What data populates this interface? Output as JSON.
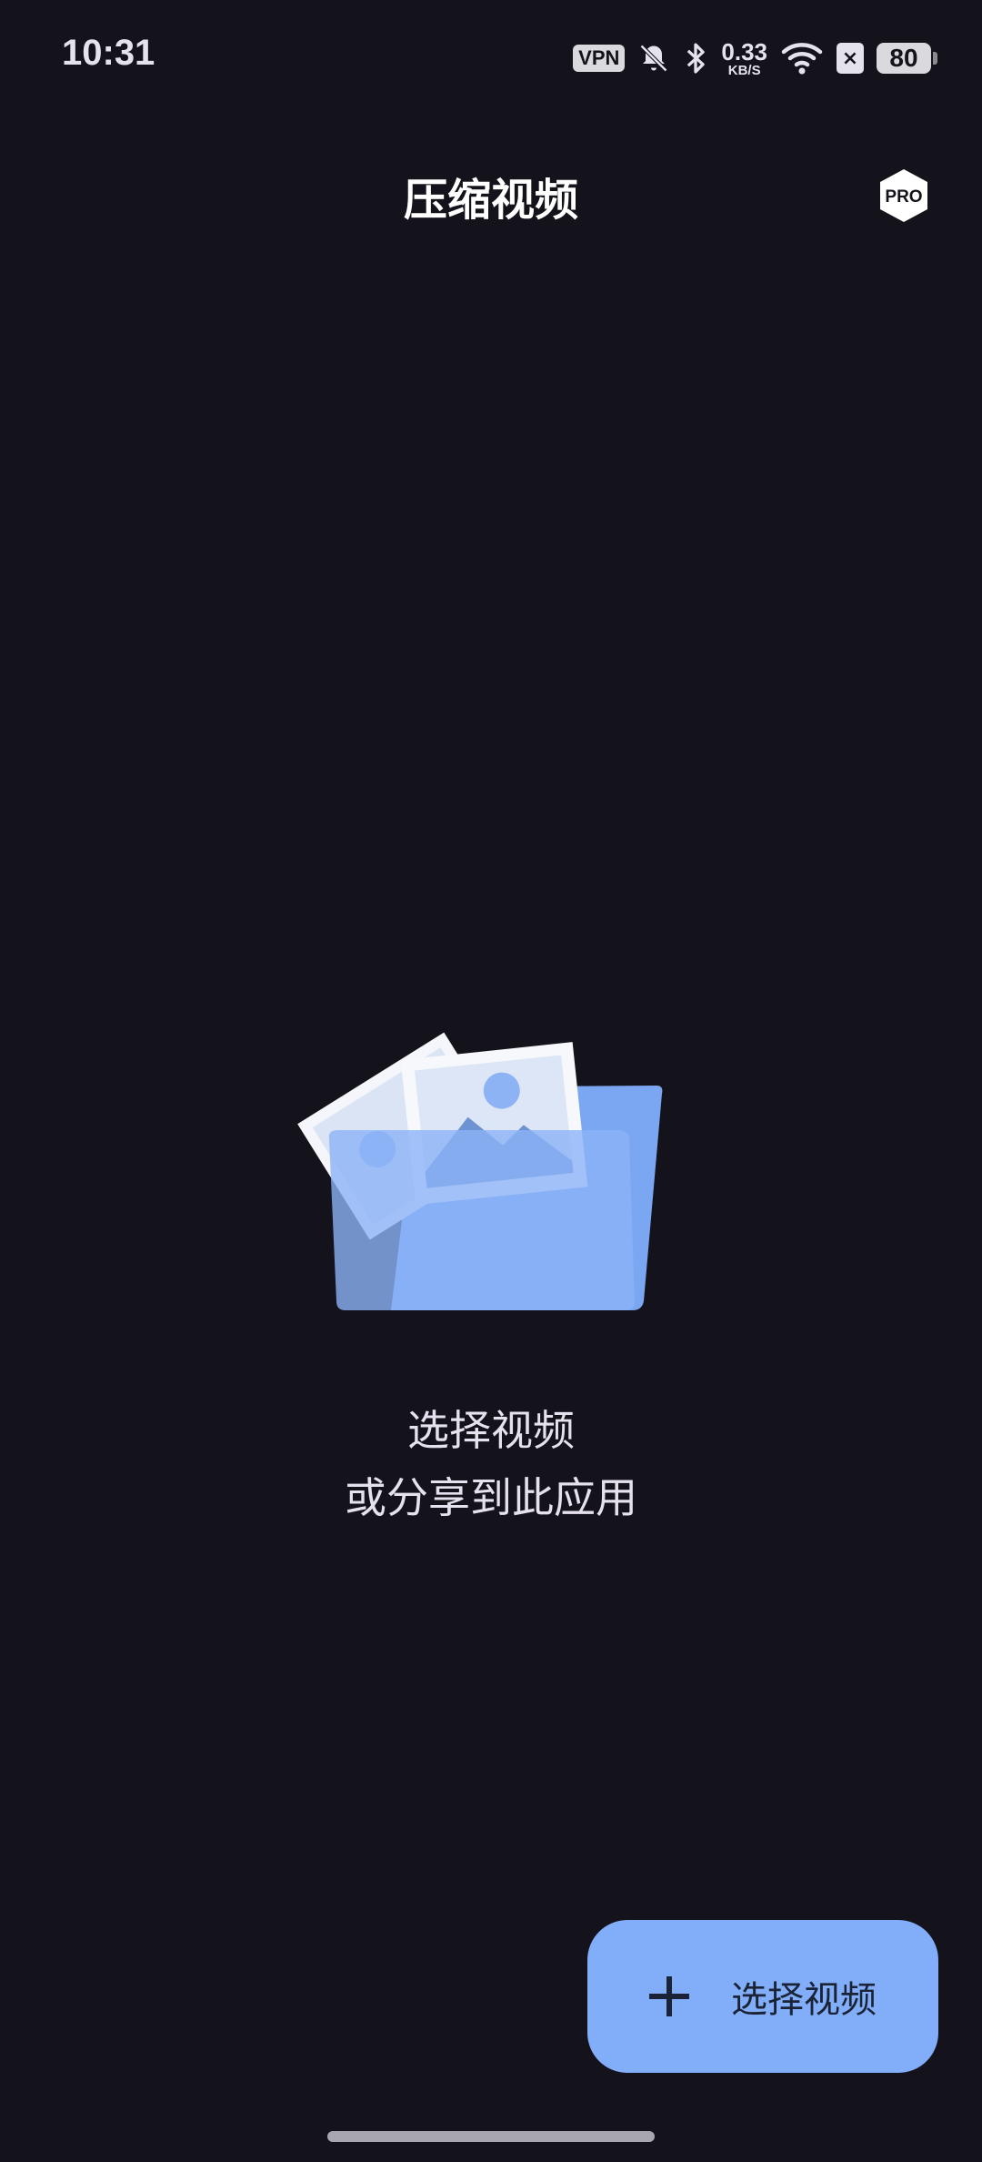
{
  "status_bar": {
    "time": "10:31",
    "vpn": "VPN",
    "speed_value": "0.33",
    "speed_unit": "KB/S",
    "sim_status": "×",
    "battery": "80"
  },
  "app_bar": {
    "title": "压缩视频",
    "pro_label": "PRO"
  },
  "empty_state": {
    "line1": "选择视频",
    "line2": "或分享到此应用"
  },
  "fab": {
    "label": "选择视频",
    "icon": "plus-icon"
  },
  "colors": {
    "background": "#14121a",
    "accent": "#82adf8",
    "text_primary": "#ffffff",
    "fab_text": "#1a2436"
  }
}
